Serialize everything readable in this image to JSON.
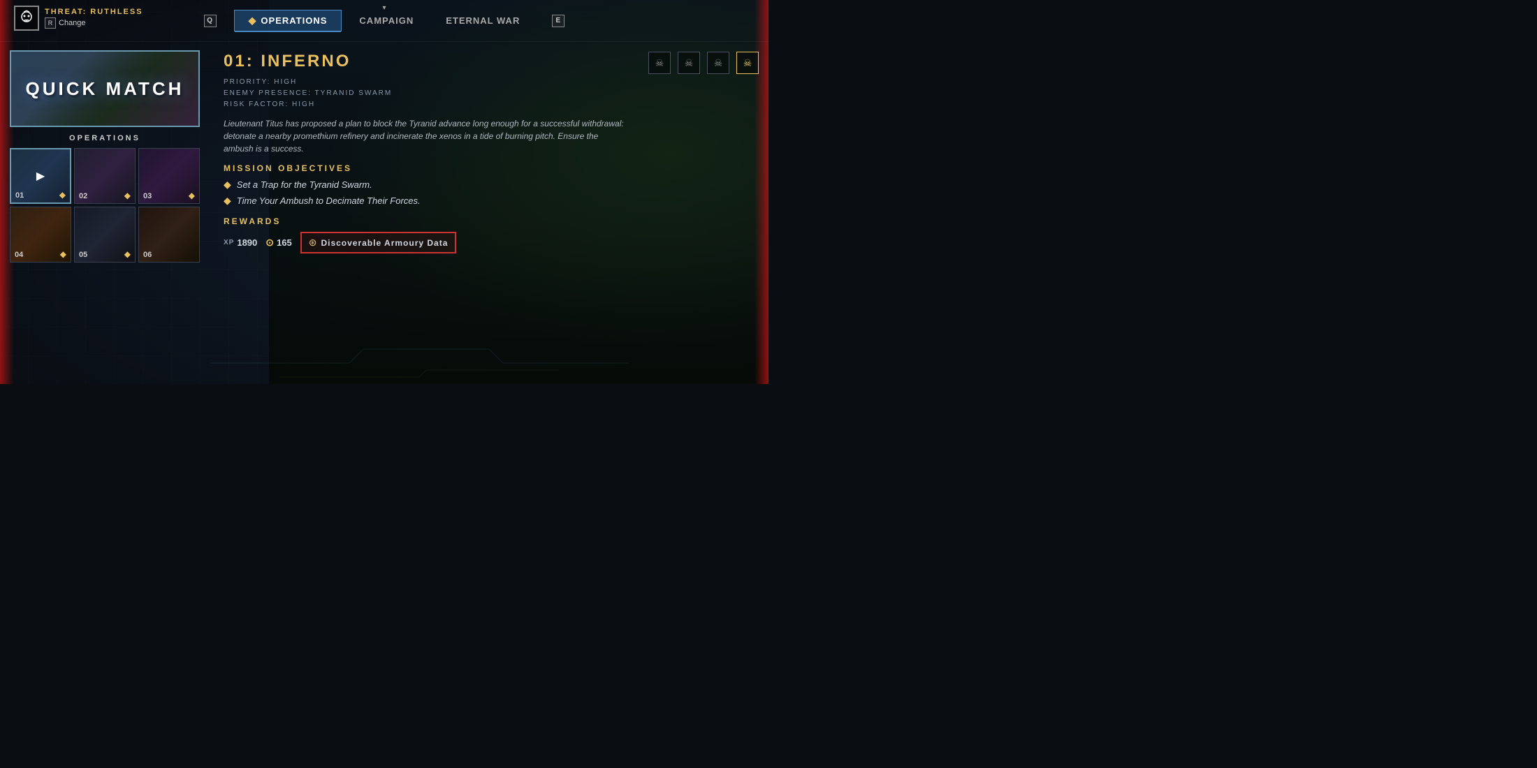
{
  "background": {
    "gradient": "dark sci-fi game UI"
  },
  "header": {
    "threat_label": "THREAT: RUTHLESS",
    "change_key": "R",
    "change_text": "Change",
    "chevron": "▾",
    "nav_tabs": [
      {
        "id": "quick",
        "key": "Q",
        "label": null,
        "active": false
      },
      {
        "id": "operations",
        "label": "Operations",
        "active": true,
        "has_diamond": true
      },
      {
        "id": "campaign",
        "label": "Campaign",
        "active": false
      },
      {
        "id": "eternal_war",
        "label": "Eternal War",
        "active": false
      },
      {
        "id": "eternal_key",
        "key": "E",
        "label": null,
        "active": false
      }
    ]
  },
  "left_panel": {
    "quick_match_text": "QUICK MATCH",
    "operations_label": "OPERATIONS",
    "op_cards": [
      {
        "id": 1,
        "number": "01",
        "active": true,
        "show_play": true
      },
      {
        "id": 2,
        "number": "02",
        "active": false
      },
      {
        "id": 3,
        "number": "03",
        "active": false
      },
      {
        "id": 4,
        "number": "04",
        "active": false
      },
      {
        "id": 5,
        "number": "05",
        "active": false
      },
      {
        "id": 6,
        "number": "06",
        "active": false
      }
    ]
  },
  "right_panel": {
    "mission_title": "01: INFERNO",
    "priority": "PRIORITY: HIGH",
    "enemy_presence": "ENEMY PRESENCE: TYRANID SWARM",
    "risk_factor": "RISK FACTOR: HIGH",
    "description": "Lieutenant Titus has proposed a plan to block the Tyranid advance long enough for a successful withdrawal: detonate a nearby promethium refinery and incinerate the xenos in a tide of burning pitch. Ensure the ambush is a success.",
    "mission_objectives_label": "MISSION OBJECTIVES",
    "objectives": [
      {
        "text": "Set a Trap for the Tyranid Swarm."
      },
      {
        "text": "Time Your Ambush to Decimate Their Forces."
      }
    ],
    "rewards_label": "REWARDS",
    "xp_label": "XP",
    "xp_value": "1890",
    "coin_value": "165",
    "armoury_text": "Discoverable Armoury Data",
    "difficulty_icons": [
      "☠",
      "☠",
      "☠",
      "☠"
    ]
  }
}
